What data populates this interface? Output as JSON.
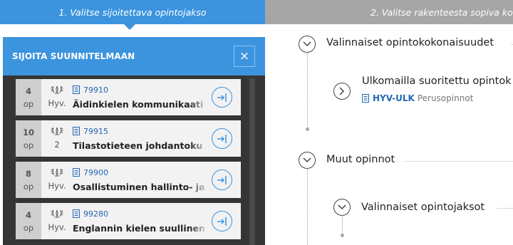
{
  "steps": {
    "step1": "1. Valitse sijoitettava opintojakso",
    "step2": "2. Valitse rakenteesta sopiva ko"
  },
  "panel": {
    "title": "SIJOITA SUUNNITELMAAN",
    "close_label": "×"
  },
  "courses": [
    {
      "credits": "4",
      "unit": "op",
      "grade": "Hyv.",
      "code": "79910",
      "name": "Äidinkielen kommunikaati"
    },
    {
      "credits": "10",
      "unit": "op",
      "grade": "2",
      "code": "79915",
      "name": "Tilastotieteen johdantoku"
    },
    {
      "credits": "8",
      "unit": "op",
      "grade": "Hyv.",
      "code": "79900",
      "name": "Osallistuminen hallinto- ja"
    },
    {
      "credits": "4",
      "unit": "op",
      "grade": "Hyv.",
      "code": "99280",
      "name": "Englannin kielen suullinen"
    }
  ],
  "tree": {
    "node1": {
      "title": "Valinnaiset opintokokonaisuudet"
    },
    "node1_child": {
      "title": "Ulkomailla suoritettu opintok",
      "code": "HYV-ULK",
      "type": "Perusopinnot"
    },
    "node2": {
      "title": "Muut opinnot"
    },
    "node2_child": {
      "title": "Valinnaiset opintojaksot"
    }
  },
  "icons": {
    "close": "close-icon",
    "place": "place-in-plan-icon",
    "chevron": "chevron-icon",
    "laurel": "laurel-icon",
    "document": "document-icon"
  },
  "colors": {
    "accent": "#3c94de",
    "panel_bg": "#353535",
    "inactive_step": "#a6a6a6",
    "link": "#2467b5"
  }
}
